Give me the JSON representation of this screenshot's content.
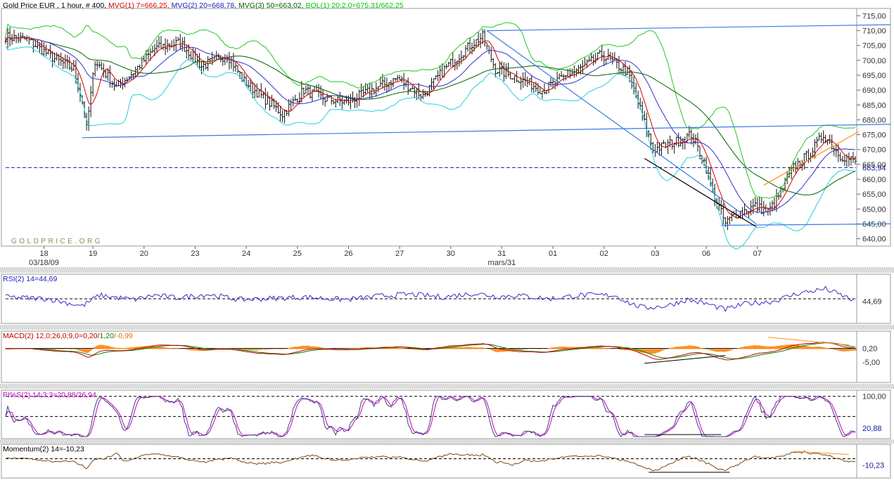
{
  "chart_data": [
    {
      "type": "ohlc",
      "title_parts": [
        {
          "text": "Gold Price EUR , 1 hour, # 400, ",
          "color": "#000000"
        },
        {
          "text": "MVG(1) 7=666,25, ",
          "color": "#d40000"
        },
        {
          "text": "MVG(2) 20=668,78, ",
          "color": "#2020c0"
        },
        {
          "text": "MVG(3) 50=663,02, ",
          "color": "#006400"
        },
        {
          "text": "BOL(1) 20;2,0=675,31/662,25",
          "color": "#00c800"
        }
      ],
      "watermark": "GOLDPRICE.ORG",
      "ylim": [
        638,
        717
      ],
      "y_ticks": [
        640,
        645,
        650,
        655,
        660,
        665,
        670,
        675,
        680,
        685,
        690,
        695,
        700,
        705,
        710,
        715
      ],
      "y_tick_labels": [
        "640,00",
        "645,00",
        "650,00",
        "655,00",
        "660,00",
        "665,00",
        "670,00",
        "675,00",
        "680,00",
        "685,00",
        "690,00",
        "695,00",
        "700,00",
        "705,00",
        "710,00",
        "715,00"
      ],
      "last_value": 663.94,
      "last_value_label": "663,94",
      "dashed_level": 663.94,
      "x_ticks": [
        {
          "label": "18",
          "i": 18
        },
        {
          "label": "19",
          "i": 41
        },
        {
          "label": "20",
          "i": 65
        },
        {
          "label": "23",
          "i": 89
        },
        {
          "label": "24",
          "i": 113
        },
        {
          "label": "25",
          "i": 137
        },
        {
          "label": "26",
          "i": 161
        },
        {
          "label": "27",
          "i": 185
        },
        {
          "label": "30",
          "i": 209
        },
        {
          "label": "31",
          "i": 233
        },
        {
          "label": "01",
          "i": 257
        },
        {
          "label": "02",
          "i": 281
        },
        {
          "label": "03",
          "i": 305
        },
        {
          "label": "06",
          "i": 329
        },
        {
          "label": "07",
          "i": 353
        }
      ],
      "x_sublabels": [
        {
          "label": "03/18/09",
          "i": 18
        },
        {
          "label": "mars/31",
          "i": 233
        }
      ],
      "bar_count": 400,
      "price_path": [
        [
          0,
          708
        ],
        [
          10,
          707
        ],
        [
          22,
          701
        ],
        [
          32,
          697
        ],
        [
          36,
          686
        ],
        [
          38,
          677
        ],
        [
          42,
          700
        ],
        [
          52,
          691
        ],
        [
          60,
          696
        ],
        [
          70,
          704
        ],
        [
          82,
          706
        ],
        [
          92,
          698
        ],
        [
          104,
          702
        ],
        [
          112,
          693
        ],
        [
          120,
          688
        ],
        [
          130,
          682
        ],
        [
          140,
          690
        ],
        [
          150,
          687
        ],
        [
          160,
          686
        ],
        [
          172,
          690
        ],
        [
          184,
          694
        ],
        [
          196,
          688
        ],
        [
          206,
          697
        ],
        [
          218,
          705
        ],
        [
          224,
          708
        ],
        [
          230,
          697
        ],
        [
          244,
          693
        ],
        [
          252,
          690
        ],
        [
          264,
          695
        ],
        [
          272,
          698
        ],
        [
          280,
          702
        ],
        [
          288,
          698
        ],
        [
          292,
          696
        ],
        [
          296,
          688
        ],
        [
          304,
          670
        ],
        [
          312,
          672
        ],
        [
          316,
          673
        ],
        [
          322,
          675
        ],
        [
          328,
          666
        ],
        [
          332,
          656
        ],
        [
          338,
          645
        ],
        [
          342,
          648
        ],
        [
          352,
          651
        ],
        [
          358,
          649
        ],
        [
          362,
          653
        ],
        [
          370,
          664
        ],
        [
          378,
          669
        ],
        [
          384,
          675
        ],
        [
          392,
          668
        ],
        [
          399,
          666
        ]
      ],
      "trend_lines": [
        {
          "color": "#3a7be0",
          "from": [
            36,
            674
          ],
          "to": [
            399,
            678.5
          ]
        },
        {
          "color": "#3a7be0",
          "from": [
            226,
            710
          ],
          "to": [
            399,
            712
          ]
        },
        {
          "color": "#3a7be0",
          "from": [
            226,
            710
          ],
          "to": [
            336,
            645
          ]
        },
        {
          "color": "#3a7be0",
          "from": [
            336,
            644.5
          ],
          "to": [
            399,
            645
          ]
        },
        {
          "color": "#000000",
          "from": [
            300,
            667
          ],
          "to": [
            336,
            644
          ]
        },
        {
          "color": "#ff8c1a",
          "from": [
            356,
            658
          ],
          "to": [
            384,
            676
          ]
        }
      ]
    },
    {
      "type": "line",
      "label": "RSI(2) 14=44,69",
      "label_color": "#2020c0",
      "series": [
        {
          "color": "#3030c8",
          "path": [
            [
              0,
              54
            ],
            [
              20,
              50
            ],
            [
              36,
              34
            ],
            [
              44,
              58
            ],
            [
              60,
              48
            ],
            [
              70,
              58
            ],
            [
              80,
              52
            ],
            [
              95,
              60
            ],
            [
              110,
              48
            ],
            [
              120,
              50
            ],
            [
              140,
              54
            ],
            [
              160,
              48
            ],
            [
              175,
              56
            ],
            [
              190,
              60
            ],
            [
              205,
              54
            ],
            [
              220,
              62
            ],
            [
              232,
              55
            ],
            [
              240,
              58
            ],
            [
              255,
              50
            ],
            [
              270,
              58
            ],
            [
              286,
              58
            ],
            [
              294,
              38
            ],
            [
              300,
              30
            ],
            [
              310,
              34
            ],
            [
              320,
              48
            ],
            [
              330,
              38
            ],
            [
              338,
              26
            ],
            [
              348,
              40
            ],
            [
              360,
              44
            ],
            [
              372,
              62
            ],
            [
              385,
              72
            ],
            [
              394,
              55
            ],
            [
              399,
              44.69
            ]
          ]
        }
      ],
      "ylim": [
        0,
        100
      ],
      "levels": [
        {
          "value": 50,
          "dashed": true
        }
      ],
      "last_value_label": "44,69"
    },
    {
      "type": "line+histogram",
      "label_parts": [
        {
          "text": "MACD(2) 12,0;26,0;9,0=0,20/",
          "color": "#c00000"
        },
        {
          "text": "1,20",
          "color": "#008000"
        },
        {
          "text": "/-0,99",
          "color": "#e07000"
        }
      ],
      "ylim": [
        -12,
        6
      ],
      "levels": [
        {
          "value": 0.2,
          "dashed": false
        }
      ],
      "y_tick_labels": [
        "0,20",
        "-5,00"
      ],
      "y_ticks": [
        0.2,
        -5
      ],
      "trend_lines": [
        {
          "color": "#000000",
          "from": [
            300,
            -5.5
          ],
          "to": [
            338,
            -2.5
          ]
        },
        {
          "color": "#ff8c1a",
          "from": [
            358,
            4.5
          ],
          "to": [
            396,
            1.5
          ]
        }
      ]
    },
    {
      "type": "line",
      "label": "PI%S(2) 14;3;3=20,88/26,94",
      "label_color": "#c000c0",
      "ylim": [
        0,
        110
      ],
      "levels": [
        {
          "value": 100,
          "dashed": true
        },
        {
          "value": 50,
          "dashed": true
        }
      ],
      "y_tick_labels": [
        "100,00",
        "20,88"
      ],
      "y_ticks": [
        100,
        20.88
      ],
      "trend_lines": [
        {
          "color": "#000000",
          "from": [
            300,
            5
          ],
          "to": [
            336,
            5
          ]
        }
      ]
    },
    {
      "type": "line",
      "label": "Momentum(2) 14=-10,23",
      "label_color": "#000000",
      "ylim": [
        -28,
        20
      ],
      "levels": [
        {
          "value": 0,
          "dashed": true
        }
      ],
      "y_tick_labels": [
        "-10,23"
      ],
      "y_ticks": [
        -10.23
      ],
      "trend_lines": [
        {
          "color": "#000000",
          "from": [
            302,
            -22
          ],
          "to": [
            340,
            -22
          ]
        },
        {
          "color": "#ff8c1a",
          "from": [
            370,
            12
          ],
          "to": [
            396,
            7
          ]
        }
      ]
    }
  ]
}
